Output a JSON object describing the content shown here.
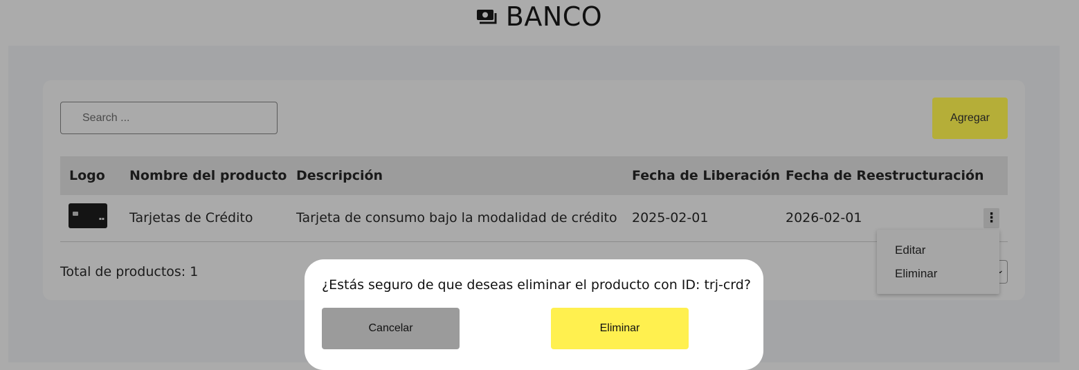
{
  "app": {
    "title": "BANCO",
    "icon": "money-bill-icon"
  },
  "toolbar": {
    "search_placeholder": "Search ...",
    "add_label": "Agregar",
    "add_color": "#b5ae38"
  },
  "table": {
    "columns": [
      "Logo",
      "Nombre del producto",
      "Descripción",
      "Fecha de Liberación",
      "Fecha de Reestructuración"
    ],
    "rows": [
      {
        "logo": "credit-card-image",
        "name": "Tarjetas de Crédito",
        "description": "Tarjeta de consumo bajo la modalidad de crédito",
        "release_date": "2025-02-01",
        "restructure_date": "2026-02-01",
        "actions_icon": "⋮"
      }
    ]
  },
  "footer": {
    "total_label": "Total de productos: 1",
    "pager_icon": "chevron-down-icon"
  },
  "context_menu": {
    "items": [
      "Editar",
      "Eliminar"
    ]
  },
  "modal": {
    "message": "¿Estás seguro de que deseas eliminar el producto con ID: trj-crd?",
    "cancel_label": "Cancelar",
    "confirm_label": "Eliminar",
    "confirm_color": "#fff04f"
  }
}
